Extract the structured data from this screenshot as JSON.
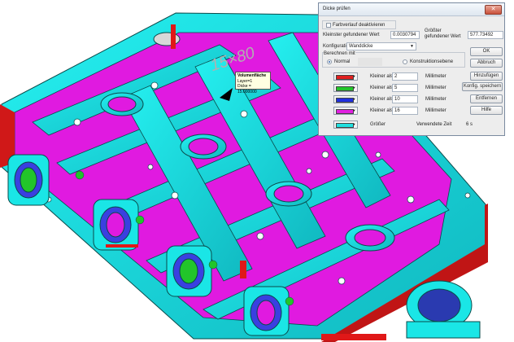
{
  "tooltip": {
    "title": "Volumenfläche",
    "layer": "Layer=1",
    "thickness": "Dicke = 15.000000"
  },
  "dimension_text": "15×80",
  "dialog": {
    "title": "Dicke prüfen",
    "close_glyph": "✕",
    "gradient_label": "Farbverlauf deaktivieren",
    "min_label": "Kleinster gefundener Wert",
    "min_value": "0.0030794",
    "max_label_1": "Größter",
    "max_label_2": "gefundener Wert",
    "max_value": "577.73492",
    "config_label": "Konfiguration",
    "config_value": "Wanddicke",
    "compute_label": "Berechnen mit",
    "radio_normal": "Normal",
    "radio_construction": "Konstruktionsebene",
    "rows": [
      {
        "color": "#e02020",
        "op": "Kleiner als",
        "value": "2",
        "unit": "Millimeter"
      },
      {
        "color": "#22c52a",
        "op": "Kleiner als",
        "value": "5",
        "unit": "Millimeter"
      },
      {
        "color": "#2030e0",
        "op": "Kleiner als",
        "value": "10",
        "unit": "Millimeter"
      },
      {
        "color": "#e020e0",
        "op": "Kleiner als",
        "value": "16",
        "unit": "Millimeter"
      }
    ],
    "last_row": {
      "color": "#20e0e0",
      "op": "Größer"
    },
    "time_label": "Verwendete Zeit",
    "time_value": "6 s",
    "buttons": {
      "ok": "OK",
      "cancel": "Abbruch",
      "add": "Hinzufügen",
      "save": "Konfig. speichern",
      "remove": "Entfernen",
      "help": "Hilfe"
    }
  },
  "colors": {
    "cyan": "#15e6e6",
    "magenta": "#e01ae0",
    "red": "#e01818",
    "dark": "#0c3c3c"
  }
}
